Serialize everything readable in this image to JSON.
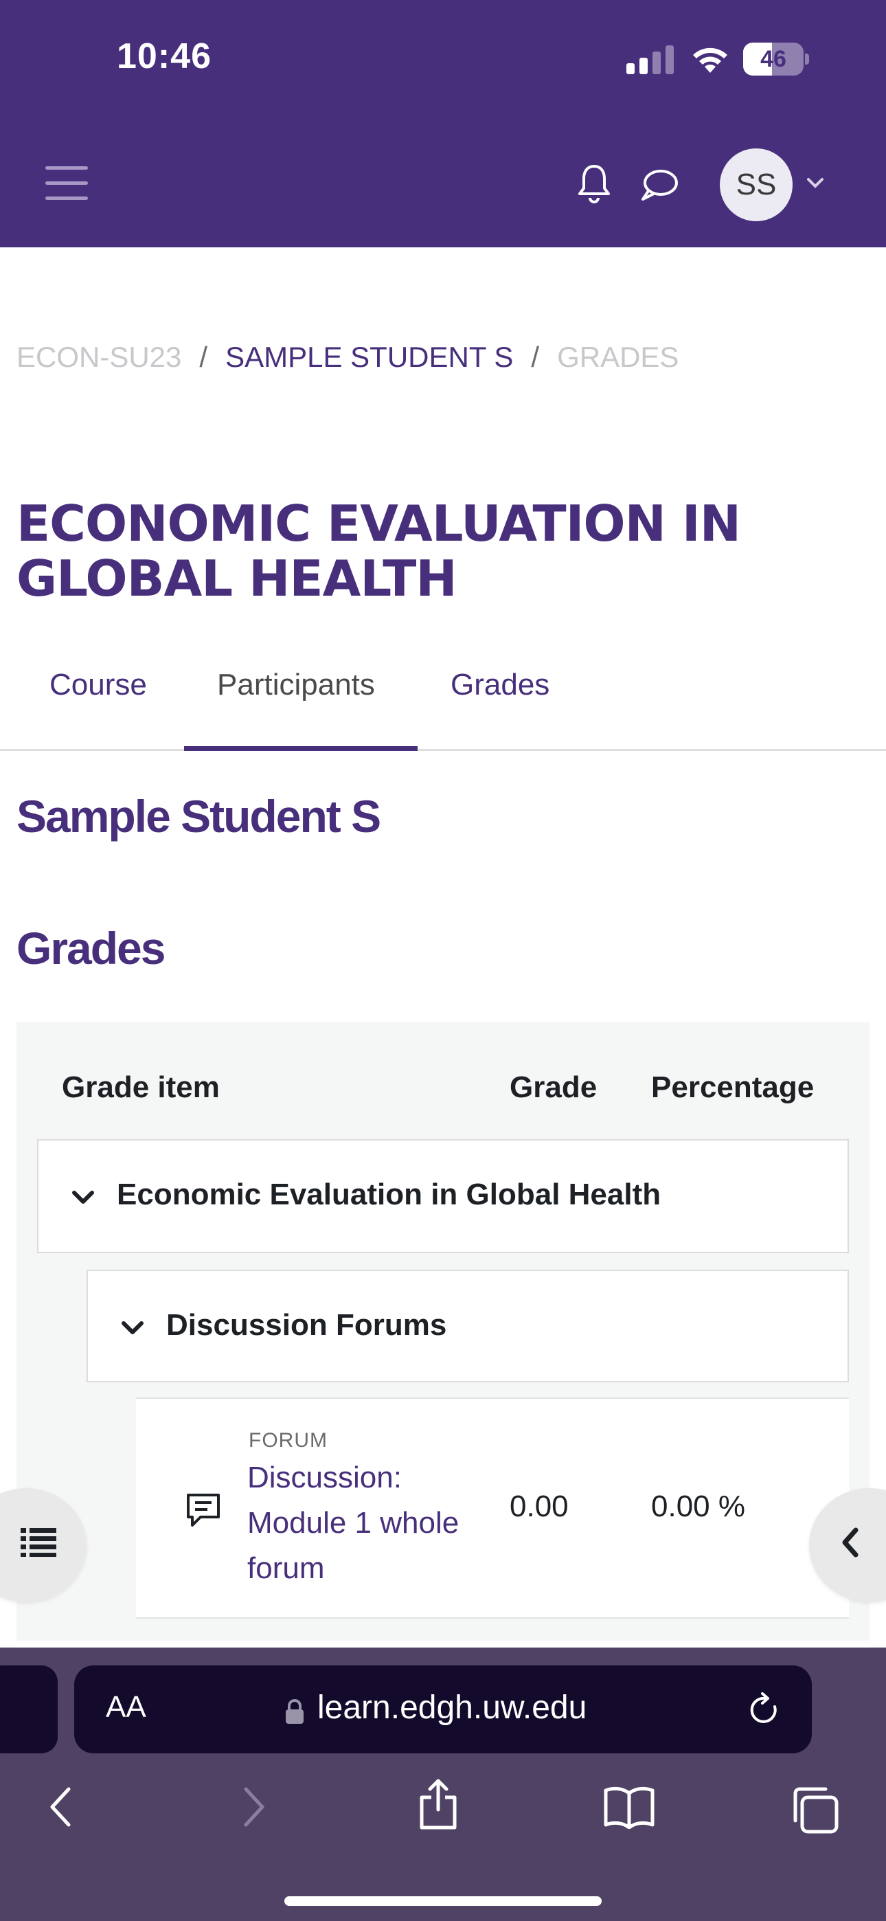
{
  "status_bar": {
    "time": "10:46",
    "battery": "46"
  },
  "nav": {
    "avatar_initials": "SS"
  },
  "breadcrumb": {
    "items": [
      "ECON-SU23",
      "SAMPLE STUDENT S",
      "GRADES"
    ],
    "separator": "/"
  },
  "course": {
    "title": "ECONOMIC EVALUATION IN GLOBAL HEALTH"
  },
  "tabs": [
    {
      "label": "Course"
    },
    {
      "label": "Participants",
      "active": true
    },
    {
      "label": "Grades"
    }
  ],
  "student": {
    "name": "Sample Student S"
  },
  "grades": {
    "heading": "Grades",
    "columns": [
      "Grade item",
      "Grade",
      "Percentage"
    ],
    "category": "Economic Evaluation in Global Health",
    "subcategory": "Discussion Forums",
    "items": [
      {
        "type": "FORUM",
        "name": "Discussion: Module 1 whole forum",
        "grade": "0.00",
        "percentage": "0.00 %"
      }
    ]
  },
  "browser": {
    "text_size_label": "AA",
    "url": "learn.edgh.uw.edu"
  },
  "colors": {
    "brand": "#472f7c",
    "safari_bar": "#4f4264",
    "address_bg": "#130a2c"
  }
}
